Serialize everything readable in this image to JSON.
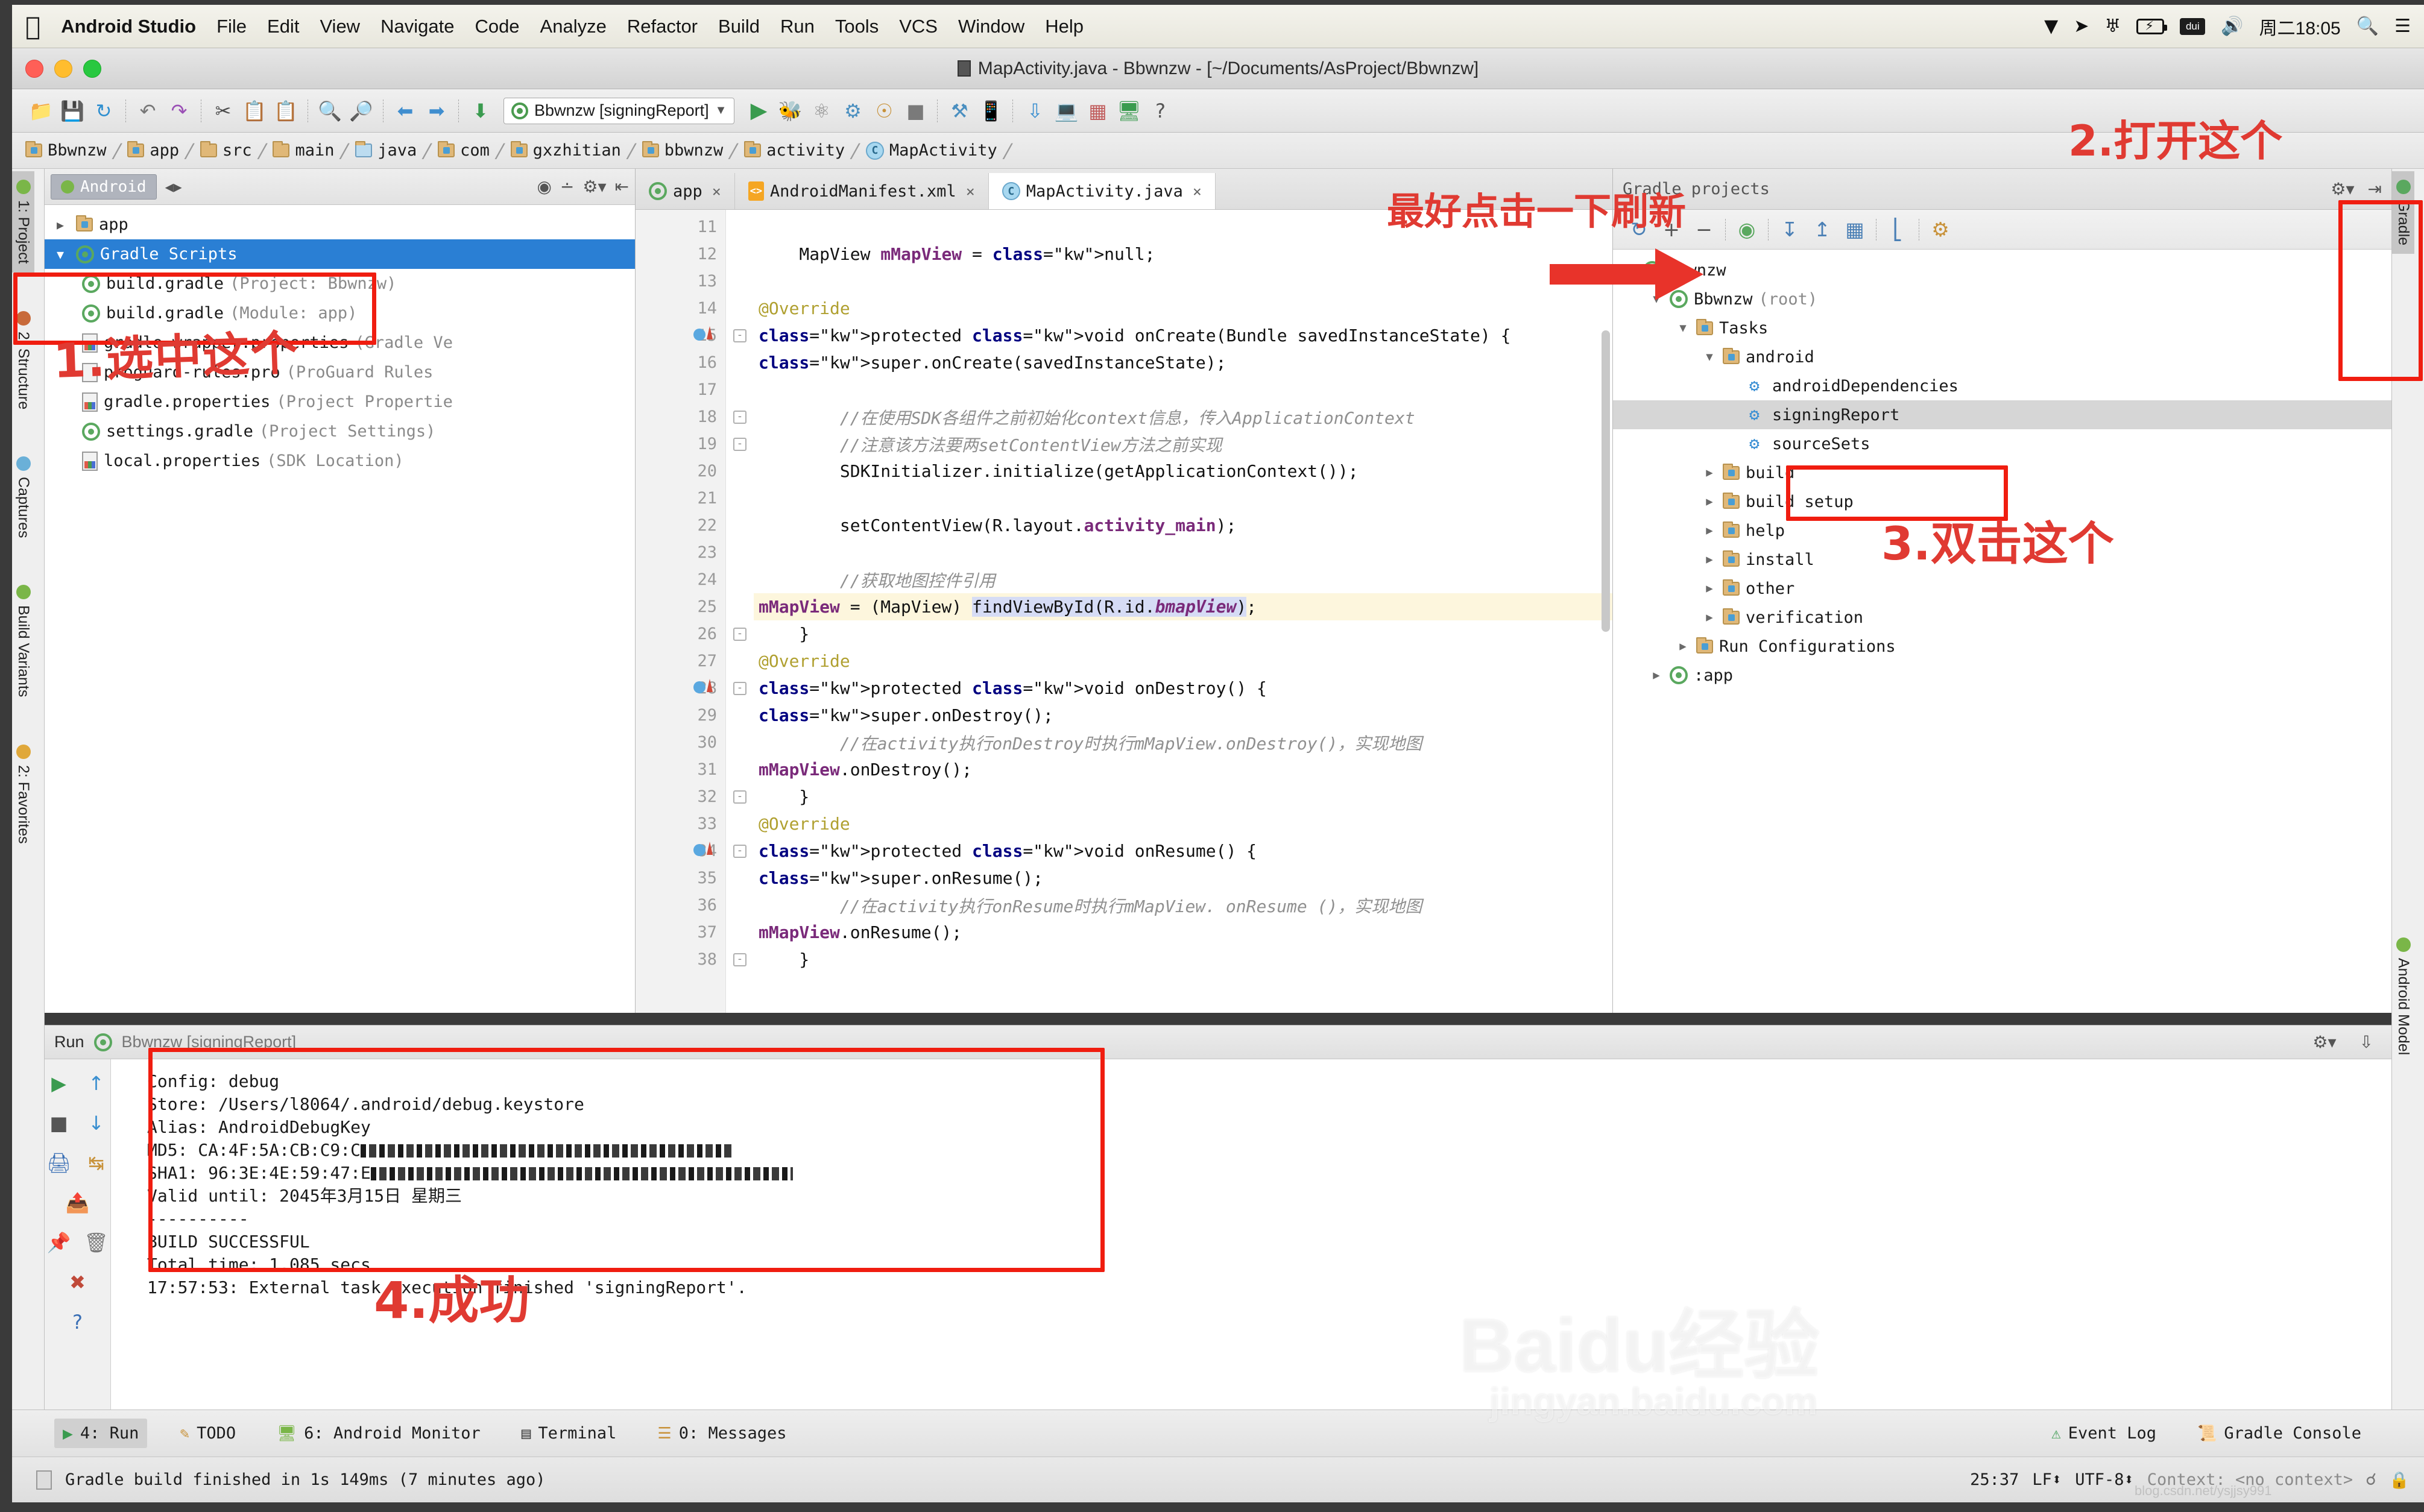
{
  "macbar": {
    "apple_icon": "apple-logo-icon",
    "app_name": "Android Studio",
    "menus": [
      "File",
      "Edit",
      "View",
      "Navigate",
      "Code",
      "Analyze",
      "Refactor",
      "Build",
      "Run",
      "Tools",
      "VCS",
      "Window",
      "Help"
    ],
    "status_icons": [
      "dropbox-icon",
      "telegram-icon",
      "wifi-icon",
      "battery-icon",
      "dui-icon",
      "volume-icon"
    ],
    "clock": "周二18:05",
    "search_icon": "search-icon",
    "notification_center_icon": "list-icon"
  },
  "titlebar": {
    "title": "MapActivity.java - Bbwnzw - [~/Documents/AsProject/Bbwnzw]"
  },
  "toolbar": {
    "icons": [
      "open-folder-icon",
      "save-icon",
      "sync-icon",
      "undo-icon",
      "redo-icon",
      "cut-icon",
      "copy-icon",
      "paste-icon",
      "find-icon",
      "replace-icon",
      "back-icon",
      "forward-icon",
      "compile-icon"
    ],
    "run_config": "Bbwnzw [signingReport]",
    "right_icons": [
      "run-icon",
      "debug-icon",
      "coverage-icon",
      "apply-changes-icon",
      "attach-debugger-icon",
      "stop-icon",
      "sdk-manager-icon",
      "avd-manager-icon",
      "sync-gradle-icon",
      "android-device-monitor-icon",
      "project-structure-icon",
      "android-icon",
      "help-icon"
    ]
  },
  "breadcrumb": [
    {
      "label": "Bbwnzw",
      "icon": "folder-module-icon"
    },
    {
      "label": "app",
      "icon": "folder-module-icon"
    },
    {
      "label": "src",
      "icon": "folder-icon"
    },
    {
      "label": "main",
      "icon": "folder-icon"
    },
    {
      "label": "java",
      "icon": "folder-source-icon"
    },
    {
      "label": "com",
      "icon": "folder-package-icon"
    },
    {
      "label": "gxzhitian",
      "icon": "folder-package-icon"
    },
    {
      "label": "bbwnzw",
      "icon": "folder-package-icon"
    },
    {
      "label": "activity",
      "icon": "folder-package-icon"
    },
    {
      "label": "MapActivity",
      "icon": "class-icon"
    }
  ],
  "left_rail": [
    {
      "label": "1: Project",
      "icon": "android-icon",
      "selected": true
    },
    {
      "label": "2: Structure",
      "icon": "structure-icon",
      "selected": false
    },
    {
      "label": "Captures",
      "icon": "captures-icon",
      "selected": false
    },
    {
      "label": "Build Variants",
      "icon": "android-icon",
      "selected": false
    },
    {
      "label": "2: Favorites",
      "icon": "star-icon",
      "selected": false
    }
  ],
  "right_rail": [
    {
      "label": "Gradle",
      "icon": "gradle-icon",
      "selected": true
    },
    {
      "label": "Android Model",
      "icon": "android-icon",
      "selected": false
    }
  ],
  "project_panel": {
    "view_selector": "Android",
    "view_icon": "android-head-icon",
    "expand_icon": "expand-collapse-icon",
    "header_icons": [
      "target-icon",
      "collapse-all-icon",
      "gear-icon",
      "hide-icon"
    ],
    "tree": [
      {
        "label": "app",
        "detail": "",
        "indent": 0,
        "arrow": "▶",
        "icon": "folder-module-icon",
        "selected": false
      },
      {
        "label": "Gradle Scripts",
        "detail": "",
        "indent": 0,
        "arrow": "▼",
        "icon": "gradle-icon",
        "selected": true
      },
      {
        "label": "build.gradle",
        "detail": "(Project: Bbwnzw)",
        "indent": 1,
        "arrow": "",
        "icon": "gradle-icon",
        "selected": false
      },
      {
        "label": "build.gradle",
        "detail": "(Module: app)",
        "indent": 1,
        "arrow": "",
        "icon": "gradle-icon",
        "selected": false
      },
      {
        "label": "gradle-wrapper.properties",
        "detail": "(Gradle Ve",
        "indent": 1,
        "arrow": "",
        "icon": "properties-icon",
        "selected": false
      },
      {
        "label": "proguard-rules.pro",
        "detail": "(ProGuard Rules",
        "indent": 1,
        "arrow": "",
        "icon": "file-icon",
        "selected": false
      },
      {
        "label": "gradle.properties",
        "detail": "(Project Propertie",
        "indent": 1,
        "arrow": "",
        "icon": "properties-icon",
        "selected": false
      },
      {
        "label": "settings.gradle",
        "detail": "(Project Settings)",
        "indent": 1,
        "arrow": "",
        "icon": "gradle-icon",
        "selected": false
      },
      {
        "label": "local.properties",
        "detail": "(SDK Location)",
        "indent": 1,
        "arrow": "",
        "icon": "properties-icon",
        "selected": false
      }
    ]
  },
  "editor": {
    "tabs": [
      {
        "label": "app",
        "icon": "gradle-icon",
        "active": false,
        "close": "×"
      },
      {
        "label": "AndroidManifest.xml",
        "icon": "xml-icon",
        "active": false,
        "close": "×"
      },
      {
        "label": "MapActivity.java",
        "icon": "class-icon",
        "active": true,
        "close": "×"
      }
    ],
    "first_line_number": 11,
    "lines": [
      {
        "n": 11,
        "text": "",
        "highlight": false,
        "mark": false,
        "fold": ""
      },
      {
        "n": 12,
        "text": "    MapView mMapView = null;",
        "highlight": false,
        "mark": false,
        "fold": ""
      },
      {
        "n": 13,
        "text": "",
        "highlight": false,
        "mark": false,
        "fold": ""
      },
      {
        "n": 14,
        "text": "    @Override",
        "highlight": false,
        "mark": false,
        "fold": ""
      },
      {
        "n": 15,
        "text": "    protected void onCreate(Bundle savedInstanceState) {",
        "highlight": false,
        "mark": true,
        "fold": "-"
      },
      {
        "n": 16,
        "text": "        super.onCreate(savedInstanceState);",
        "highlight": false,
        "mark": false,
        "fold": ""
      },
      {
        "n": 17,
        "text": "",
        "highlight": false,
        "mark": false,
        "fold": ""
      },
      {
        "n": 18,
        "text": "        //在使用SDK各组件之前初始化context信息，传入ApplicationContext",
        "highlight": false,
        "mark": false,
        "fold": "-"
      },
      {
        "n": 19,
        "text": "        //注意该方法要两setContentView方法之前实现",
        "highlight": false,
        "mark": false,
        "fold": "-"
      },
      {
        "n": 20,
        "text": "        SDKInitializer.initialize(getApplicationContext());",
        "highlight": false,
        "mark": false,
        "fold": ""
      },
      {
        "n": 21,
        "text": "",
        "highlight": false,
        "mark": false,
        "fold": ""
      },
      {
        "n": 22,
        "text": "        setContentView(R.layout.activity_main);",
        "highlight": false,
        "mark": false,
        "fold": ""
      },
      {
        "n": 23,
        "text": "",
        "highlight": false,
        "mark": false,
        "fold": ""
      },
      {
        "n": 24,
        "text": "        //获取地图控件引用",
        "highlight": false,
        "mark": false,
        "fold": ""
      },
      {
        "n": 25,
        "text": "        mMapView = (MapView) findViewById(R.id.bmapView);",
        "highlight": true,
        "mark": false,
        "fold": ""
      },
      {
        "n": 26,
        "text": "    }",
        "highlight": false,
        "mark": false,
        "fold": "-"
      },
      {
        "n": 27,
        "text": "    @Override",
        "highlight": false,
        "mark": false,
        "fold": ""
      },
      {
        "n": 28,
        "text": "    protected void onDestroy() {",
        "highlight": false,
        "mark": true,
        "fold": "-"
      },
      {
        "n": 29,
        "text": "        super.onDestroy();",
        "highlight": false,
        "mark": false,
        "fold": ""
      },
      {
        "n": 30,
        "text": "        //在activity执行onDestroy时执行mMapView.onDestroy()，实现地图",
        "highlight": false,
        "mark": false,
        "fold": ""
      },
      {
        "n": 31,
        "text": "        mMapView.onDestroy();",
        "highlight": false,
        "mark": false,
        "fold": ""
      },
      {
        "n": 32,
        "text": "    }",
        "highlight": false,
        "mark": false,
        "fold": "-"
      },
      {
        "n": 33,
        "text": "    @Override",
        "highlight": false,
        "mark": false,
        "fold": ""
      },
      {
        "n": 34,
        "text": "    protected void onResume() {",
        "highlight": false,
        "mark": true,
        "fold": "-"
      },
      {
        "n": 35,
        "text": "        super.onResume();",
        "highlight": false,
        "mark": false,
        "fold": ""
      },
      {
        "n": 36,
        "text": "        //在activity执行onResume时执行mMapView. onResume ()，实现地图",
        "highlight": false,
        "mark": false,
        "fold": ""
      },
      {
        "n": 37,
        "text": "        mMapView.onResume();",
        "highlight": false,
        "mark": false,
        "fold": ""
      },
      {
        "n": 38,
        "text": "    }",
        "highlight": false,
        "mark": false,
        "fold": "-"
      }
    ]
  },
  "gradle_panel": {
    "title": "Gradle projects",
    "header_icons": [
      "gear-icon",
      "hide-icon"
    ],
    "toolbar_icons": [
      "refresh-icon",
      "add-icon",
      "remove-icon",
      "execute-task-icon",
      "expand-all-icon",
      "collapse-all-icon",
      "toggle-offline-icon",
      "toggle-tasks-icon",
      "settings-icon"
    ],
    "tree": [
      {
        "label": "Bbwnzw",
        "detail": "",
        "indent": 0,
        "arrow": "▼",
        "icon": "gradle-icon",
        "selected": false
      },
      {
        "label": "Bbwnzw",
        "detail": "(root)",
        "indent": 1,
        "arrow": "▼",
        "icon": "gradle-icon",
        "selected": false
      },
      {
        "label": "Tasks",
        "detail": "",
        "indent": 2,
        "arrow": "▼",
        "icon": "folder-task-icon",
        "selected": false
      },
      {
        "label": "android",
        "detail": "",
        "indent": 3,
        "arrow": "▼",
        "icon": "folder-task-icon",
        "selected": false
      },
      {
        "label": "androidDependencies",
        "detail": "",
        "indent": 4,
        "arrow": "",
        "icon": "task-gear-icon",
        "selected": false
      },
      {
        "label": "signingReport",
        "detail": "",
        "indent": 4,
        "arrow": "",
        "icon": "task-gear-icon",
        "selected": true
      },
      {
        "label": "sourceSets",
        "detail": "",
        "indent": 4,
        "arrow": "",
        "icon": "task-gear-icon",
        "selected": false
      },
      {
        "label": "build",
        "detail": "",
        "indent": 3,
        "arrow": "▶",
        "icon": "folder-task-icon",
        "selected": false
      },
      {
        "label": "build setup",
        "detail": "",
        "indent": 3,
        "arrow": "▶",
        "icon": "folder-task-icon",
        "selected": false
      },
      {
        "label": "help",
        "detail": "",
        "indent": 3,
        "arrow": "▶",
        "icon": "folder-task-icon",
        "selected": false
      },
      {
        "label": "install",
        "detail": "",
        "indent": 3,
        "arrow": "▶",
        "icon": "folder-task-icon",
        "selected": false
      },
      {
        "label": "other",
        "detail": "",
        "indent": 3,
        "arrow": "▶",
        "icon": "folder-task-icon",
        "selected": false
      },
      {
        "label": "verification",
        "detail": "",
        "indent": 3,
        "arrow": "▶",
        "icon": "folder-task-icon",
        "selected": false
      },
      {
        "label": "Run Configurations",
        "detail": "",
        "indent": 2,
        "arrow": "▶",
        "icon": "folder-task-icon",
        "selected": false
      },
      {
        "label": ":app",
        "detail": "",
        "indent": 1,
        "arrow": "▶",
        "icon": "gradle-icon",
        "selected": false
      }
    ]
  },
  "run_panel": {
    "title_label": "Run",
    "config_label": "Bbwnzw [signingReport]",
    "rail_icons": [
      "run-icon",
      "up-icon",
      "stop-icon",
      "down-icon",
      "print-icon",
      "wrap-icon",
      "export-icon",
      "pin-icon",
      "close-icon",
      "trash-icon",
      "help-icon"
    ],
    "header_icons": [
      "gear-icon",
      "hide-icon"
    ],
    "console_lines": [
      "Config: debug",
      "Store: /Users/l8064/.android/debug.keystore",
      "Alias: AndroidDebugKey",
      "MD5: CA:4F:5A:CB:C9:C",
      "SHA1: 96:3E:4E:59:47:E",
      "Valid until: 2045年3月15日 星期三",
      "----------",
      "",
      "BUILD SUCCESSFUL",
      "",
      "Total time: 1.085 secs",
      "17:57:53: External task execution finished 'signingReport'."
    ]
  },
  "bottom_tabs": {
    "left": [
      {
        "label": "4: Run",
        "icon": "run-icon",
        "selected": true
      },
      {
        "label": "TODO",
        "icon": "todo-icon",
        "selected": false
      },
      {
        "label": "6: Android Monitor",
        "icon": "android-icon",
        "selected": false
      },
      {
        "label": "Terminal",
        "icon": "terminal-icon",
        "selected": false
      },
      {
        "label": "0: Messages",
        "icon": "messages-icon",
        "selected": false
      }
    ],
    "right": [
      {
        "label": "Event Log",
        "icon": "event-log-icon",
        "selected": false
      },
      {
        "label": "Gradle Console",
        "icon": "gradle-console-icon",
        "selected": false
      }
    ]
  },
  "statusbar": {
    "message": "Gradle build finished in 1s 149ms (7 minutes ago)",
    "caret": "25:37",
    "line_sep": "LF⬍",
    "encoding": "UTF-8⬍",
    "context": "Context: <no context>",
    "lock_icon": "lock-icon",
    "branch_icon": "branch-icon"
  },
  "annotations": [
    {
      "id": "step1",
      "text": "1.选中这个"
    },
    {
      "id": "step2",
      "text": "2.打开这个"
    },
    {
      "id": "step3",
      "text": "3.双击这个"
    },
    {
      "id": "step4",
      "text": "4.成功"
    },
    {
      "id": "refresh_hint",
      "text": "最好点击一下刷新"
    }
  ],
  "watermark": {
    "main": "Baidu经验",
    "sub": "jingyan.baidu.com",
    "csdn": "blog.csdn.net/ysjjsy991"
  },
  "colors": {
    "accent_red": "#f01d10",
    "selection_blue": "#2a7fd4",
    "gradle_green": "#5aa85f",
    "highlight_yellow": "#fdf6dd"
  }
}
